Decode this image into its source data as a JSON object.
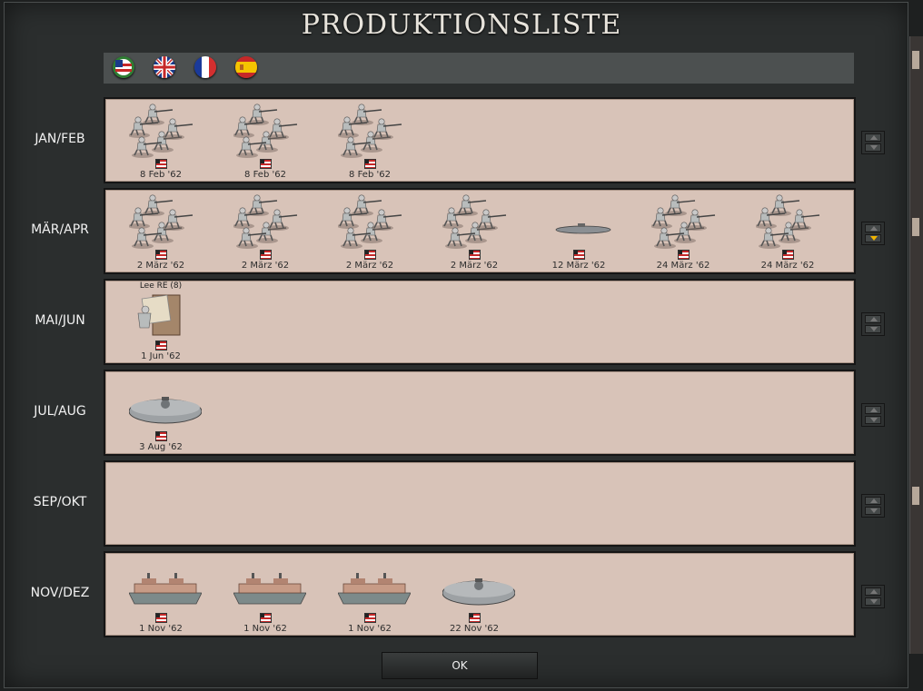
{
  "window": {
    "title": "PRODUKTIONSLISTE"
  },
  "flags": [
    {
      "name": "confederacy-flag-icon",
      "label": "Konföderation"
    },
    {
      "name": "uk-flag-icon",
      "label": "Großbritannien"
    },
    {
      "name": "france-flag-icon",
      "label": "Frankreich"
    },
    {
      "name": "spain-flag-icon",
      "label": "Spanien"
    }
  ],
  "rows": [
    {
      "label": "JAN/FEB",
      "units": [
        {
          "type": "infantry",
          "date": "8 Feb '62"
        },
        {
          "type": "infantry",
          "date": "8 Feb '62"
        },
        {
          "type": "infantry",
          "date": "8 Feb '62"
        }
      ]
    },
    {
      "label": "MÄR/APR",
      "units": [
        {
          "type": "infantry",
          "date": "2 März '62"
        },
        {
          "type": "infantry",
          "date": "2 März '62"
        },
        {
          "type": "infantry",
          "date": "2 März '62"
        },
        {
          "type": "infantry",
          "date": "2 März '62"
        },
        {
          "type": "submarine",
          "date": "12 März '62"
        },
        {
          "type": "infantry",
          "date": "24 März '62"
        },
        {
          "type": "infantry",
          "date": "24 März '62"
        }
      ]
    },
    {
      "label": "MAI/JUN",
      "units": [
        {
          "type": "leader",
          "name": "Lee RE (8)",
          "date": "1 Jun '62"
        }
      ]
    },
    {
      "label": "JUL/AUG",
      "units": [
        {
          "type": "ironclad",
          "date": "3 Aug '62"
        }
      ]
    },
    {
      "label": "SEP/OKT",
      "units": []
    },
    {
      "label": "NOV/DEZ",
      "units": [
        {
          "type": "riverboat",
          "date": "1 Nov '62"
        },
        {
          "type": "riverboat",
          "date": "1 Nov '62"
        },
        {
          "type": "riverboat",
          "date": "1 Nov '62"
        },
        {
          "type": "ironclad",
          "date": "22 Nov '62"
        }
      ]
    }
  ],
  "scroll_active_row": 1,
  "ok_label": "OK",
  "colors": {
    "panel": "#d8c3b8",
    "accent_arrow": "#f0b400",
    "frame": "#2b2e2e"
  }
}
